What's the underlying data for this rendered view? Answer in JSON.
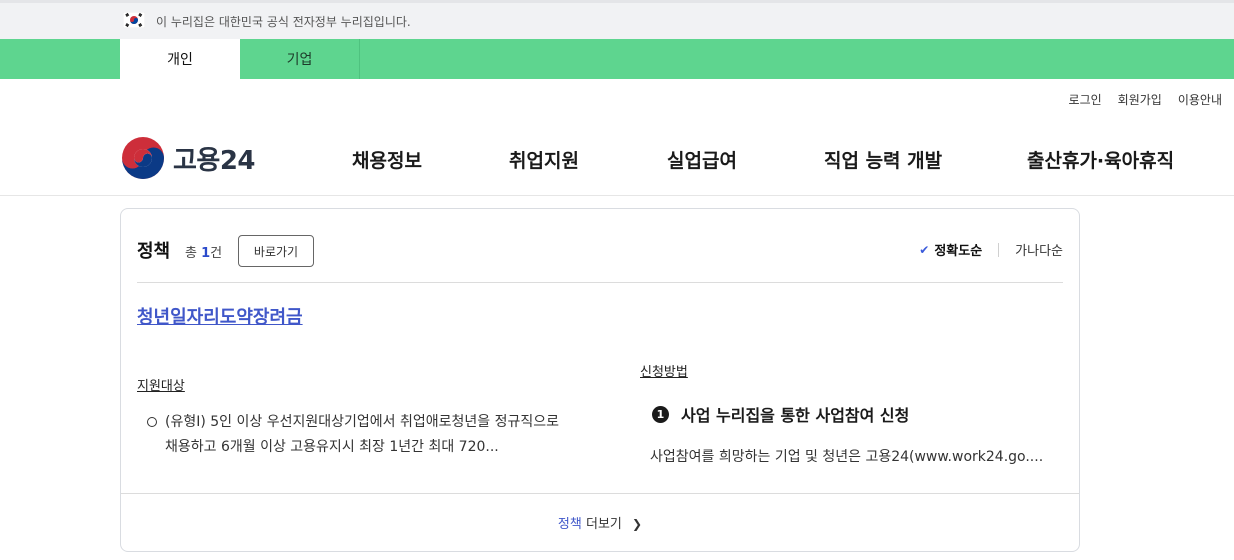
{
  "gov_banner": {
    "text": "이 누리집은 대한민국 공식 전자정부 누리집입니다."
  },
  "user_tabs": [
    {
      "label": "개인",
      "active": true
    },
    {
      "label": "기업",
      "active": false
    }
  ],
  "utility_links": [
    "로그인",
    "회원가입",
    "이용안내"
  ],
  "logo": {
    "text": "고용24"
  },
  "main_menu": [
    "채용정보",
    "취업지원",
    "실업급여",
    "직업 능력 개발",
    "출산휴가·육아휴직"
  ],
  "result_card": {
    "title": "정책",
    "count_prefix": "총",
    "count": "1",
    "count_suffix": "건",
    "go_button": "바로가기",
    "sort_accuracy": "정확도순",
    "sort_alpha": "가나다순",
    "policy_title": "청년일자리도약장려금",
    "support_target_label": "지원대상",
    "support_target_text": "(유형I) 5인 이상 우선지원대상기업에서 취업애로청년을 정규직으로 채용하고 6개월 이상 고용유지시 최장 1년간 최대 720...",
    "apply_method_label": "신청방법",
    "apply_step_number": "1",
    "apply_step_title": "사업 누리집을 통한 사업참여 신청",
    "apply_desc": "사업참여를 희망하는 기업 및 청년은 고용24(www.work24.go....",
    "more_keyword": "정책",
    "more_text": "더보기"
  },
  "colors": {
    "green_bar": "#5ed58f",
    "link_blue": "#4057c9",
    "count_blue": "#2b4acb"
  },
  "icons": {
    "flag": "korea-flag-icon",
    "check": "check-icon",
    "chevron": "chevron-right-icon",
    "logo": "taegeuk-logo-icon"
  }
}
